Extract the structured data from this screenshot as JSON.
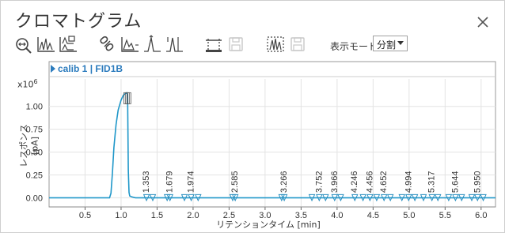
{
  "window": {
    "title": "クロマトグラム"
  },
  "toolbar": {
    "icons": [
      "zoom-fit-icon",
      "overlay-chart-icon",
      "stacked-chart-icon",
      "link-icon",
      "peak-integrate-icon",
      "baseline-icon",
      "peak-split-icon",
      "cursor-measure-icon",
      "save-disabled-icon",
      "peak-label-icon",
      "save-disabled-icon-2"
    ],
    "mode_label": "表示モード",
    "mode_value": "分割"
  },
  "chart_data": {
    "type": "line",
    "title": "calib 1 | FID1B",
    "xlabel": "リテンションタイム [min]",
    "ylabel": "レスポンス [pA]",
    "y_multiplier": "x10 6",
    "xlim": [
      0.0,
      6.2
    ],
    "ylim": [
      -0.1,
      1.3
    ],
    "x_ticks": [
      0.5,
      1.0,
      1.5,
      2.0,
      2.5,
      3.0,
      3.5,
      4.0,
      4.5,
      5.0,
      5.5,
      6.0
    ],
    "x_tick_labels": [
      "0.5",
      "1.0",
      "1.5",
      "2.0",
      "2.5",
      "3.0",
      "3.5",
      "4.0",
      "4.5",
      "5.0",
      "5.5",
      "6.0"
    ],
    "y_ticks": [
      0.0,
      0.25,
      0.5,
      0.75,
      1.0
    ],
    "y_tick_labels": [
      "0.00",
      "0.25",
      "0.50",
      "0.75",
      "1.00"
    ],
    "grid": true,
    "series": [
      {
        "color": "#1f97c9",
        "x": [
          0.0,
          0.84,
          0.86,
          0.88,
          0.9,
          0.93,
          0.96,
          1.0,
          1.03,
          1.06,
          1.08,
          1.09,
          1.1,
          1.11,
          1.12,
          1.15,
          1.2,
          1.4,
          6.2
        ],
        "y": [
          0.0,
          0.0,
          0.05,
          0.28,
          0.55,
          0.8,
          0.96,
          1.07,
          1.12,
          1.14,
          1.15,
          1.13,
          0.3,
          0.06,
          0.02,
          0.01,
          0.0,
          0.0,
          0.0
        ]
      }
    ],
    "peak_markers": [
      1.353,
      1.44,
      1.64,
      1.679,
      1.88,
      1.974,
      2.07,
      2.55,
      2.585,
      3.23,
      3.266,
      3.65,
      3.752,
      3.84,
      3.966,
      4.05,
      4.246,
      4.36,
      4.456,
      4.55,
      4.652,
      4.74,
      4.9,
      4.994,
      5.08,
      5.2,
      5.317,
      5.4,
      5.55,
      5.644,
      5.73,
      5.87,
      5.95,
      6.03
    ],
    "peak_labels": [
      {
        "x": 1.353,
        "text": "1.353"
      },
      {
        "x": 1.679,
        "text": "1.679"
      },
      {
        "x": 1.974,
        "text": "1.974"
      },
      {
        "x": 2.585,
        "text": "2.585"
      },
      {
        "x": 3.266,
        "text": "3.266"
      },
      {
        "x": 3.752,
        "text": "3.752"
      },
      {
        "x": 3.966,
        "text": "3.966"
      },
      {
        "x": 4.246,
        "text": "4.246"
      },
      {
        "x": 4.456,
        "text": "4.456"
      },
      {
        "x": 4.652,
        "text": "4.652"
      },
      {
        "x": 4.994,
        "text": "4.994"
      },
      {
        "x": 5.317,
        "text": "5.317"
      },
      {
        "x": 5.644,
        "text": "5.644"
      },
      {
        "x": 5.95,
        "text": "5.950"
      }
    ]
  }
}
